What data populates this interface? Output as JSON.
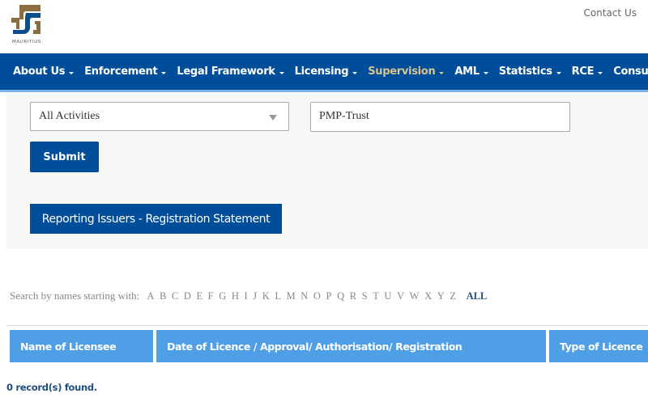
{
  "header": {
    "logo_text": "MAURITIUS",
    "logo_colors": {
      "gold": "#8c6d3f",
      "blue": "#0d4e8a"
    },
    "contact_link": "Contact Us"
  },
  "nav": {
    "items": [
      {
        "label": "About Us",
        "active": false
      },
      {
        "label": "Enforcement",
        "active": false
      },
      {
        "label": "Legal Framework",
        "active": false
      },
      {
        "label": "Licensing",
        "active": false
      },
      {
        "label": "Supervision",
        "active": true
      },
      {
        "label": "AML",
        "active": false
      },
      {
        "label": "Statistics",
        "active": false
      },
      {
        "label": "RCE",
        "active": false
      },
      {
        "label": "Consumer Protection",
        "active": false
      }
    ],
    "background": "#004d99",
    "active_color": "#d9c38f"
  },
  "filters": {
    "activity_select": {
      "value": "All Activities"
    },
    "search_input": {
      "value": "PMP-Trust",
      "placeholder": ""
    },
    "submit_label": "Submit",
    "reporting_button_label": "Reporting Issuers - Registration Statement"
  },
  "alphabet": {
    "label": "Search by names starting with:",
    "letters": [
      "A",
      "B",
      "C",
      "D",
      "E",
      "F",
      "G",
      "H",
      "I",
      "J",
      "K",
      "L",
      "M",
      "N",
      "O",
      "P",
      "Q",
      "R",
      "S",
      "T",
      "U",
      "V",
      "W",
      "X",
      "Y",
      "Z"
    ],
    "all_label": "ALL"
  },
  "table": {
    "columns": [
      "Name of Licensee",
      "Date of Licence / Approval/ Authorisation/ Registration",
      "Type of Licence"
    ],
    "rows": [],
    "header_color": "#4f9fe6"
  },
  "results": {
    "status": "0 record(s) found."
  }
}
